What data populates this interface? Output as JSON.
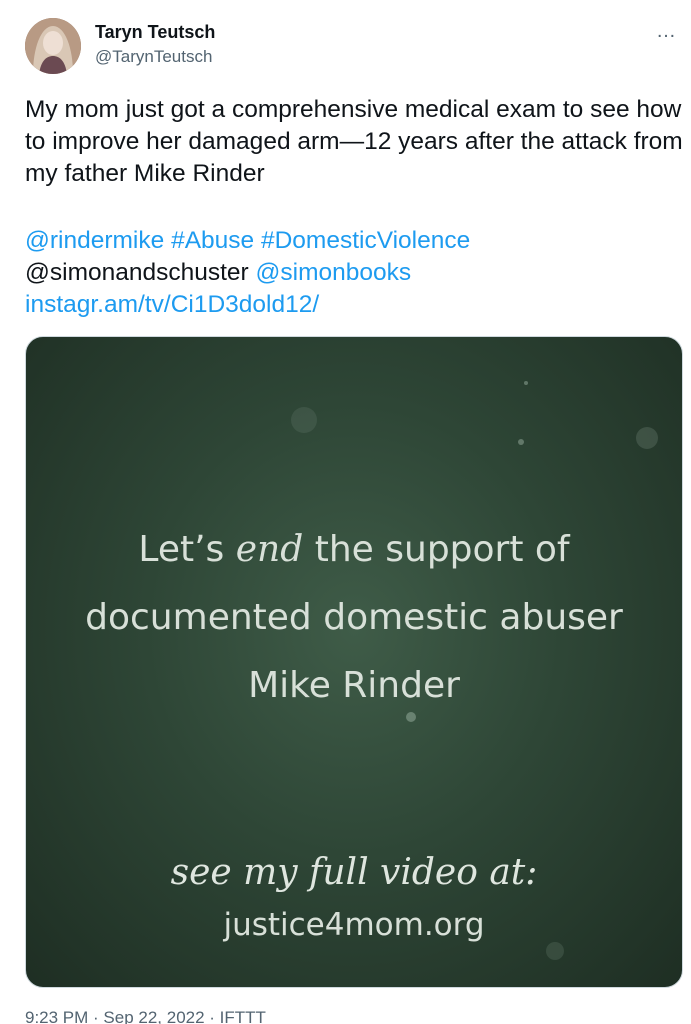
{
  "author": {
    "name": "Taryn Teutsch",
    "handle": "@TarynTeutsch"
  },
  "more_icon": "…",
  "tweet": {
    "text": "My mom just got a comprehensive medical exam to see how to improve her damaged arm—12 years after the attack from my father Mike Rinder",
    "mention1": "@rindermike",
    "hashtag1": "#Abuse",
    "hashtag2": "#DomesticViolence",
    "mention2": "@simonandschuster",
    "mention3": "@simonbooks",
    "link": "instagr.am/tv/Ci1D3dold12/"
  },
  "media": {
    "line1_before": "Let’s ",
    "line1_script": "end",
    "line1_after": " the support of",
    "line2": "documented domestic abuser",
    "line3": "Mike Rinder",
    "see_text": "see my full video at:",
    "url": "justice4mom.org"
  },
  "meta": {
    "text": "9:23 PM · Sep 22, 2022 · IFTTT"
  },
  "colors": {
    "link": "#1d9bf0",
    "text": "#0f1419",
    "secondary": "#536471",
    "media_bg": "#2e4636"
  },
  "icons": [
    "avatar",
    "more-options-icon"
  ]
}
